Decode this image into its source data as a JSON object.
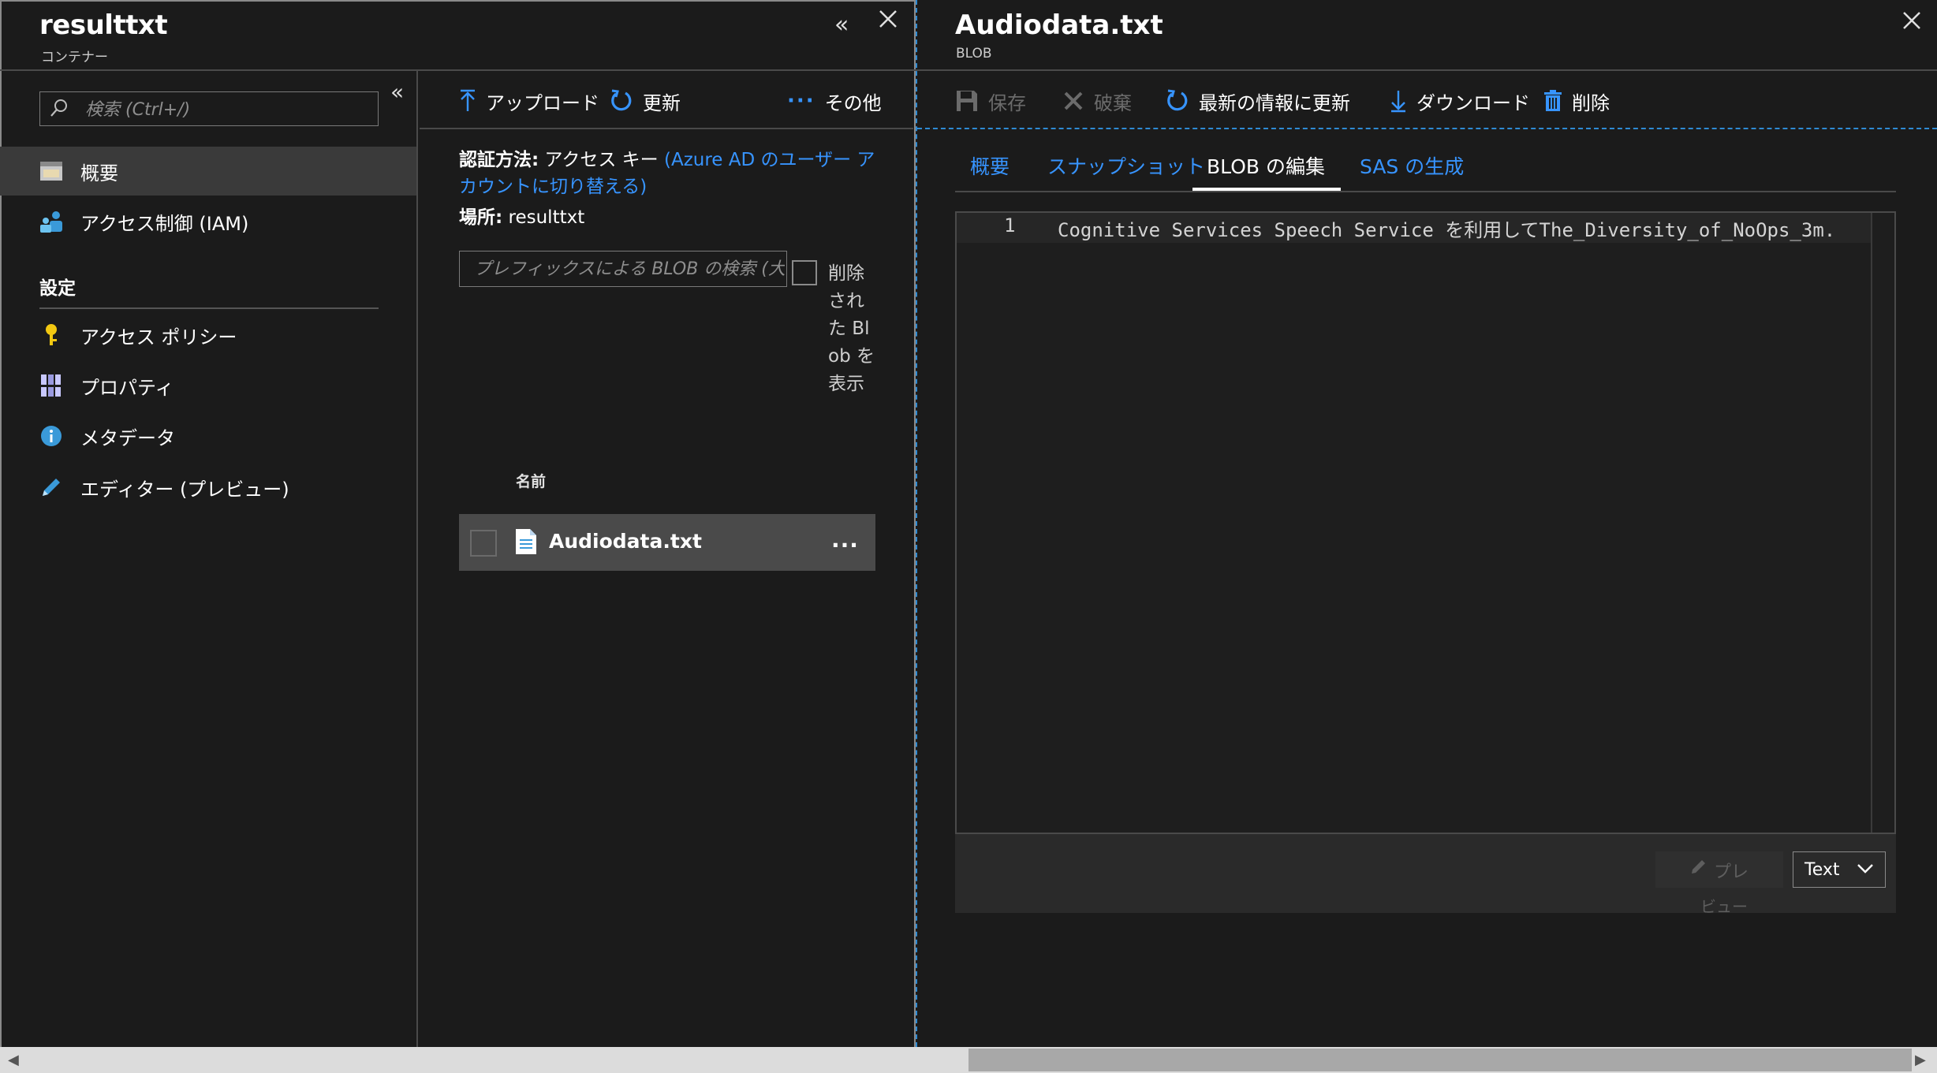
{
  "left_blade": {
    "title": "resulttxt",
    "subtitle": "コンテナー",
    "search_placeholder": "検索 (Ctrl+/)",
    "nav_items": [
      {
        "label": "概要",
        "icon": "overview-icon",
        "selected": true
      },
      {
        "label": "アクセス制御 (IAM)",
        "icon": "people-icon"
      }
    ],
    "settings_section": "設定",
    "settings_items": [
      {
        "label": "アクセス ポリシー",
        "icon": "key-icon"
      },
      {
        "label": "プロパティ",
        "icon": "properties-icon"
      },
      {
        "label": "メタデータ",
        "icon": "info-icon"
      },
      {
        "label": "エディター (プレビュー)",
        "icon": "pencil-icon"
      }
    ]
  },
  "container": {
    "toolbar": {
      "upload": "アップロード",
      "refresh": "更新",
      "more": "その他"
    },
    "auth_label": "認証方法:",
    "auth_value": "アクセス キー",
    "auth_link": "(Azure AD のユーザー アカウントに切り替える)",
    "location_label": "場所:",
    "location_value": "resulttxt",
    "blob_search_placeholder": "プレフィックスによる BLOB の検索 (大...",
    "show_deleted_label": "削除された Blob を表示",
    "column_name": "名前",
    "files": [
      {
        "name": "Audiodata.txt",
        "more": "..."
      }
    ]
  },
  "right_blade": {
    "title": "Audiodata.txt",
    "subtitle": "BLOB",
    "toolbar": {
      "save": "保存",
      "discard": "破棄",
      "refresh_latest": "最新の情報に更新",
      "download": "ダウンロード",
      "delete": "削除"
    },
    "tabs": [
      {
        "label": "概要",
        "active": false
      },
      {
        "label": "スナップショット",
        "active": false
      },
      {
        "label": "BLOB の編集",
        "active": true
      },
      {
        "label": "SAS の生成",
        "active": false
      }
    ],
    "editor": {
      "line_number": "1",
      "line_text": "Cognitive Services Speech Service を利用してThe_Diversity_of_NoOps_3m."
    },
    "preview_label_1": "プレ",
    "preview_label_2": "ビュー",
    "format_value": "Text"
  },
  "colors": {
    "accent": "#3794ff",
    "background": "#1b1b1b",
    "selected_nav": "#3a3a3a",
    "file_row": "#4a4a4a"
  }
}
